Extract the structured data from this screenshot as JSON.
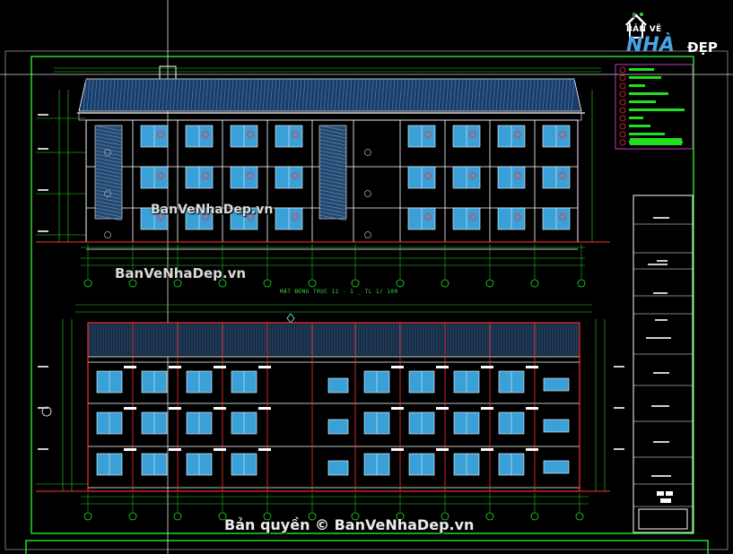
{
  "logo": {
    "top_text": "BẢN VẼ",
    "nha_text": "NHÀ",
    "dep_text": "ĐẸP"
  },
  "watermarks": {
    "upper": "BanVeNhaDep.vn",
    "middle": "BanVeNhaDep.vn",
    "copyright": "Bản quyền © BanVeNhaDep.vn"
  },
  "drawing": {
    "section_title": "MẶT ĐỨNG TRỤC 12 - 1 _ TL 1/ 100"
  },
  "colors": {
    "background": "#000000",
    "frame_green": "#22dd22",
    "window_blue": "#3aa0d8",
    "wall_line": "#ffffff",
    "dimension_red": "#ff3030",
    "roof_blue": "#2a6fa8"
  },
  "icons": [
    "house-logo-icon",
    "crosshair-cursor-icon"
  ]
}
